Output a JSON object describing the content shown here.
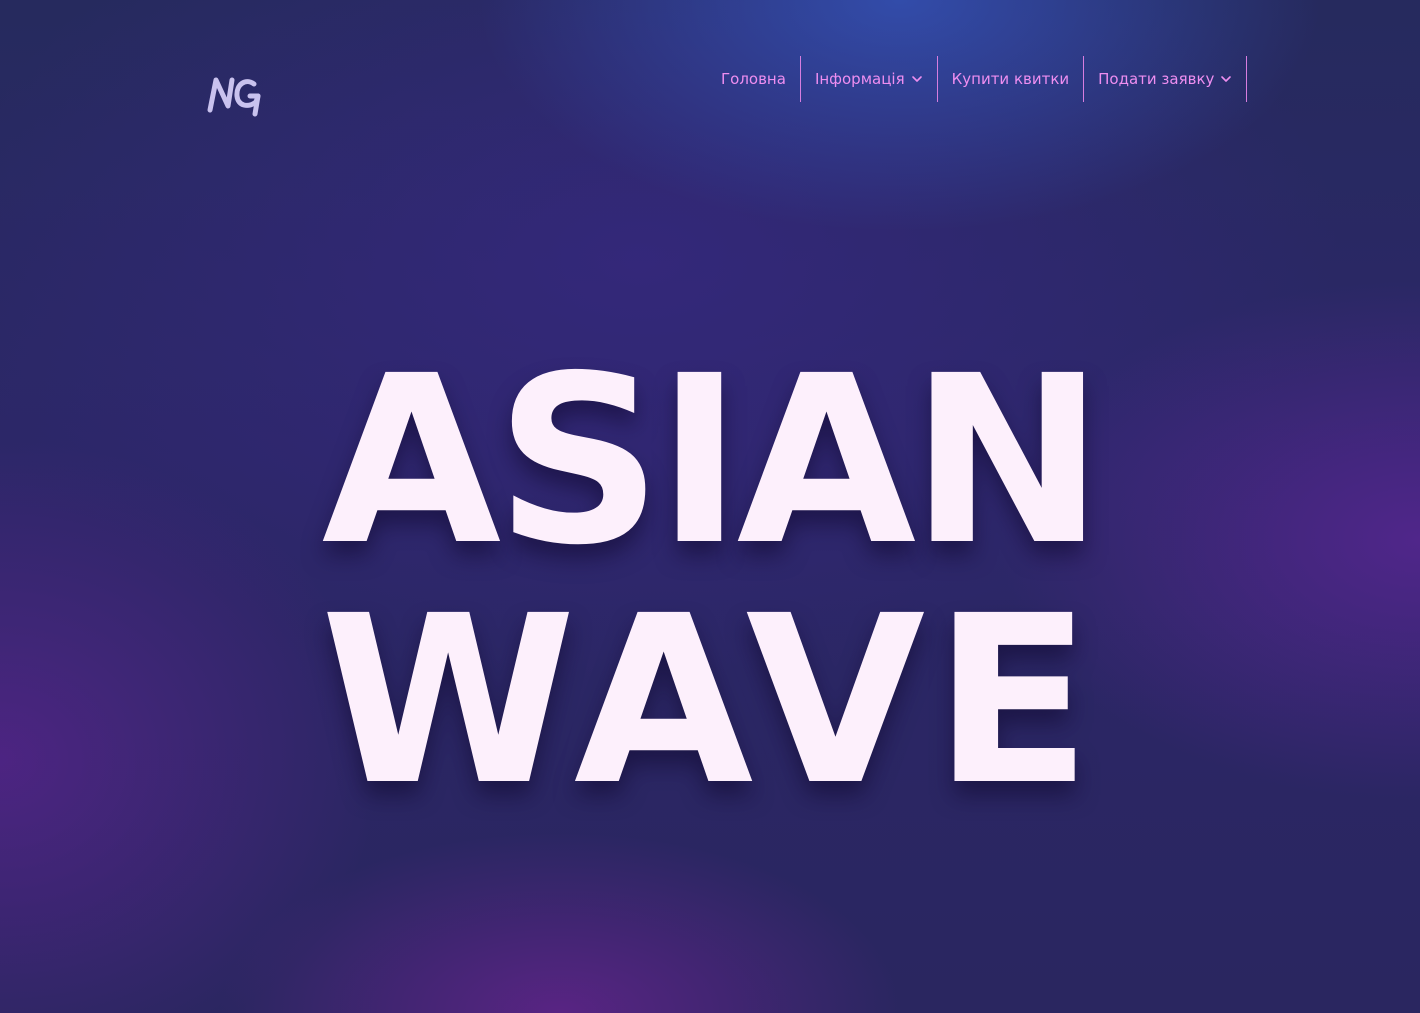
{
  "brand": {
    "logo_text": "NG",
    "logo_icon": "ng-logo-icon"
  },
  "nav": {
    "items": [
      {
        "label": "Головна",
        "has_dropdown": false
      },
      {
        "label": "Інформація",
        "has_dropdown": true,
        "icon": "chevron-down-icon"
      },
      {
        "label": "Купити квитки",
        "has_dropdown": false
      },
      {
        "label": "Подати заявку",
        "has_dropdown": true,
        "icon": "chevron-down-icon"
      }
    ]
  },
  "hero": {
    "line1": "ASIAN",
    "line2": "WAVE"
  },
  "colors": {
    "nav_text": "#ee8ef0",
    "nav_divider": "#d77ddf",
    "hero_text": "#fdf0fc",
    "logo": "#c9c2ee",
    "background_base": "#2a2660"
  }
}
